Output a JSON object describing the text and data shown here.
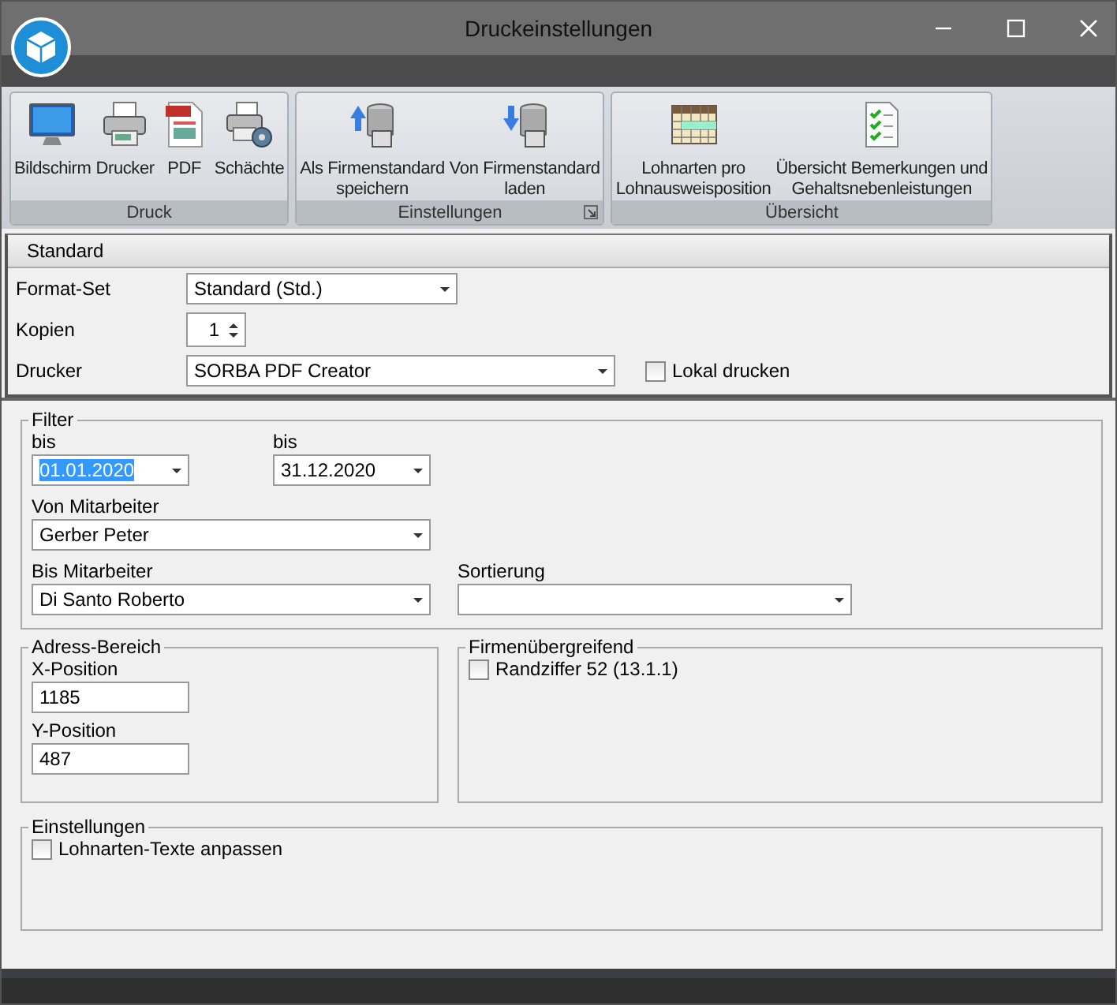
{
  "window": {
    "title": "Druckeinstellungen"
  },
  "ribbon": {
    "groups": [
      {
        "label": "Druck",
        "dialog_launcher": false,
        "buttons": [
          {
            "label": "Bildschirm",
            "kind": "screen"
          },
          {
            "label": "Drucker",
            "kind": "printer"
          },
          {
            "label": "PDF",
            "kind": "pdf"
          },
          {
            "label": "Schächte",
            "kind": "trays"
          }
        ]
      },
      {
        "label": "Einstellungen",
        "dialog_launcher": true,
        "buttons": [
          {
            "label": "Als Firmenstandard\nspeichern",
            "kind": "save"
          },
          {
            "label": "Von Firmenstandard\nladen",
            "kind": "load"
          }
        ]
      },
      {
        "label": "Übersicht",
        "dialog_launcher": false,
        "buttons": [
          {
            "label": "Lohnarten pro\nLohnausweisposition",
            "kind": "table"
          },
          {
            "label": "Übersicht Bemerkungen und\nGehaltsnebenleistungen",
            "kind": "checklist"
          }
        ]
      }
    ]
  },
  "standard": {
    "title": "Standard",
    "format_set": {
      "label": "Format-Set",
      "value": "Standard (Std.)"
    },
    "kopien": {
      "label": "Kopien",
      "value": "1"
    },
    "drucker": {
      "label": "Drucker",
      "value": "SORBA PDF Creator"
    },
    "lokal_drucken": {
      "label": "Lokal drucken",
      "checked": false
    }
  },
  "filter": {
    "title": "Filter",
    "date_from": {
      "label": "bis",
      "value": "01.01.2020",
      "text_selected": true
    },
    "date_to": {
      "label": "bis",
      "value": "31.12.2020",
      "text_selected": false
    },
    "von_mitarbeiter": {
      "label": "Von Mitarbeiter",
      "value": "Gerber Peter"
    },
    "bis_mitarbeiter": {
      "label": "Bis Mitarbeiter",
      "value": "Di Santo Roberto"
    },
    "sortierung": {
      "label": "Sortierung"
    }
  },
  "adress_bereich": {
    "title": "Adress-Bereich",
    "x_position": {
      "label": "X-Position",
      "value": "1185"
    },
    "y_position": {
      "label": "Y-Position",
      "value": "487"
    }
  },
  "firmenuebergreifend": {
    "title": "Firmenübergreifend",
    "randziffer": {
      "label": "Randziffer 52 (13.1.1)",
      "checked": false
    }
  },
  "einstellungen": {
    "title": "Einstellungen",
    "lohnarten_texte": {
      "label": "Lohnarten-Texte anpassen",
      "checked": false
    }
  }
}
